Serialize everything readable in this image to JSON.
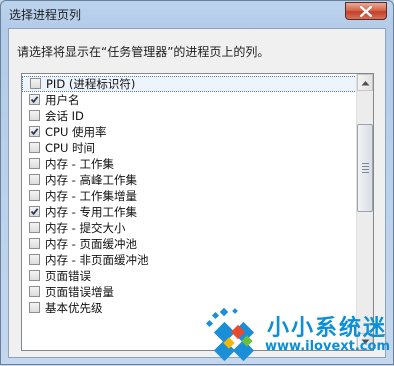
{
  "window": {
    "title": "选择进程页列"
  },
  "prompt": "请选择将显示在“任务管理器”的进程页上的列。",
  "columns": [
    {
      "label": "PID (进程标识符)",
      "checked": false,
      "focused": true
    },
    {
      "label": "用户名",
      "checked": true
    },
    {
      "label": "会话 ID",
      "checked": false
    },
    {
      "label": "CPU 使用率",
      "checked": true
    },
    {
      "label": "CPU 时间",
      "checked": false
    },
    {
      "label": "内存 - 工作集",
      "checked": false
    },
    {
      "label": "内存 - 高峰工作集",
      "checked": false
    },
    {
      "label": "内存 - 工作集增量",
      "checked": false
    },
    {
      "label": "内存 - 专用工作集",
      "checked": true
    },
    {
      "label": "内存 - 提交大小",
      "checked": false
    },
    {
      "label": "内存 - 页面缓冲池",
      "checked": false
    },
    {
      "label": "内存 - 非页面缓冲池",
      "checked": false
    },
    {
      "label": "页面错误",
      "checked": false
    },
    {
      "label": "页面错误增量",
      "checked": false
    },
    {
      "label": "基本优先级",
      "checked": false
    }
  ],
  "watermark": {
    "title": "小小系统迷",
    "url": "www.ilovext.com"
  },
  "colors": {
    "accent": "#0b8fd6",
    "close_button": "#c2412a"
  },
  "icons": {
    "close": "close-icon",
    "scroll_up": "scroll-up-icon",
    "scroll_down": "scroll-down-icon",
    "logo": "windows-logo-icon"
  }
}
